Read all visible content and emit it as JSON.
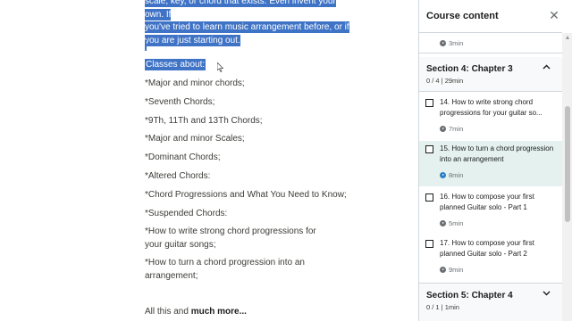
{
  "description": {
    "intro_line1": "scale, key, or chord that exists. Even invent your own. If",
    "intro_line2": "you've tried to learn music arrangement before, or if",
    "intro_line3": "you are just starting out.",
    "classes_heading": "Classes about:",
    "items": [
      "*Major and minor chords;",
      "*Seventh Chords;",
      "*9Th, 11Th and 13Th Chords;",
      "*Major and minor Scales;",
      "*Dominant Chords;",
      "*Altered Chords:",
      "*Chord Progressions and What You Need to Know;",
      "*Suspended Chords:",
      "*How to write strong chord progressions for your guitar songs;",
      "*How to turn a chord progression into an arrangement;"
    ],
    "more_prefix": "All this and ",
    "more_bold": "much more..."
  },
  "panel": {
    "title": "Course content",
    "close_icon": "close-icon",
    "prev_duration": "3min",
    "sections": [
      {
        "title": "Section 4: Chapter 3",
        "sub": "0 / 4 | 29min",
        "expanded": true,
        "lectures": [
          {
            "title": "14. How to write strong chord progressions for your guitar so...",
            "duration": "7min",
            "active": false
          },
          {
            "title": "15. How to turn a chord progression into an arrangement",
            "duration": "8min",
            "active": true
          },
          {
            "title": "16. How to compose your first planned Guitar solo - Part 1",
            "duration": "5min",
            "active": false
          },
          {
            "title": "17. How to compose your first planned Guitar solo - Part 2",
            "duration": "9min",
            "active": false
          }
        ]
      },
      {
        "title": "Section 5: Chapter 4",
        "sub": "0 / 1 | 1min",
        "expanded": false
      }
    ]
  },
  "colors": {
    "highlight": "#3f73c6",
    "active_row": "#e4f1ef",
    "active_play": "#2b7fc1"
  }
}
